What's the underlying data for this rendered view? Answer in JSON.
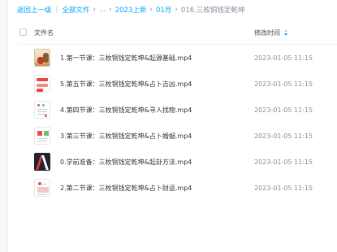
{
  "breadcrumb": {
    "back": "返回上一级",
    "root": "全部文件",
    "ellipsis": "...",
    "level1": "2023上新",
    "level2": "01月",
    "current": "016.三枚铜钱定乾坤"
  },
  "header": {
    "name_label": "文件名",
    "time_label": "修改时间"
  },
  "files": [
    {
      "name": "1.第一节课：三枚铜钱定乾坤&起源基础.mp4",
      "time": "2023-01-05 11:15",
      "thumb": "video-thumb-1"
    },
    {
      "name": "5.第五节课：三枚铜钱定乾坤&占卜吉凶.mp4",
      "time": "2023-01-05 11:15",
      "thumb": "video-thumb-5"
    },
    {
      "name": "4.第四节课：三枚铜钱定乾坤&寻人找物.mp4",
      "time": "2023-01-05 11:15",
      "thumb": "video-thumb-4"
    },
    {
      "name": "3.第三节课：三枚铜钱定乾坤&占卜婚姻.mp4",
      "time": "2023-01-05 11:15",
      "thumb": "video-thumb-3"
    },
    {
      "name": "0.学前准备：三枚铜钱定乾坤&起卦方法.mp4",
      "time": "2023-01-05 11:15",
      "thumb": "video-thumb-0"
    },
    {
      "name": "2.第二节课：三枚铜钱定乾坤&占卜财运.mp4",
      "time": "2023-01-05 11:15",
      "thumb": "video-thumb-2"
    }
  ],
  "colors": {
    "link": "#06a7ff",
    "text": "#333333",
    "muted": "#878c9c"
  }
}
